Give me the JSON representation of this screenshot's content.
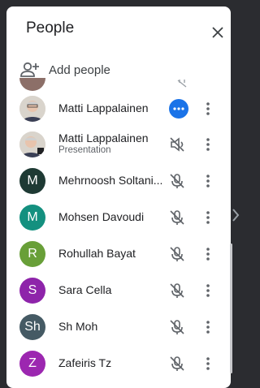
{
  "panel": {
    "title": "People",
    "close_icon": "close-icon",
    "add_people_label": "Add people",
    "add_people_icon": "person-add-icon"
  },
  "participants": [
    {
      "name": "Matti Lappalainen",
      "subtitle": "",
      "avatar": "photo",
      "status_icon": "more-horiz-active-icon"
    },
    {
      "name": "Matti Lappalainen",
      "subtitle": "Presentation",
      "avatar": "photo-presenting",
      "status_icon": "volume-off-icon"
    },
    {
      "name": "Mehrnoosh Soltani...",
      "subtitle": "",
      "avatar_letter": "M",
      "avatar_color": "#1e3a34",
      "status_icon": "mic-off-icon"
    },
    {
      "name": "Mohsen Davoudi",
      "subtitle": "",
      "avatar_letter": "M",
      "avatar_color": "#14907f",
      "status_icon": "mic-off-icon"
    },
    {
      "name": "Rohullah Bayat",
      "subtitle": "",
      "avatar_letter": "R",
      "avatar_color": "#689f38",
      "status_icon": "mic-off-icon"
    },
    {
      "name": "Sara Cella",
      "subtitle": "",
      "avatar_letter": "S",
      "avatar_color": "#8e24aa",
      "status_icon": "mic-off-icon"
    },
    {
      "name": "Sh Moh",
      "subtitle": "",
      "avatar_letter": "Sh",
      "avatar_color": "#455a64",
      "status_icon": "mic-off-icon"
    },
    {
      "name": "Zafeiris Tz",
      "subtitle": "",
      "avatar_letter": "Z",
      "avatar_color": "#9c27b0",
      "status_icon": "mic-off-icon"
    }
  ],
  "colors": {
    "accent": "#1a73e8",
    "text": "#202124",
    "icon": "#5f6368"
  }
}
